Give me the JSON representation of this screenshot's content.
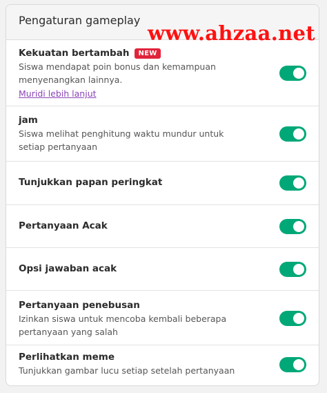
{
  "header": {
    "title": "Pengaturan gameplay",
    "watermark": "www.ahzaa.net"
  },
  "settings": [
    {
      "title": "Kekuatan bertambah",
      "badge": "NEW",
      "description": "Siswa mendapat poin bonus dan kemampuan menyenangkan lainnya.",
      "link": "Muridi lebih lanjut",
      "enabled": true
    },
    {
      "title": "jam",
      "description": "Siswa melihat penghitung waktu mundur untuk setiap pertanyaan",
      "enabled": true
    },
    {
      "title": "Tunjukkan papan peringkat",
      "enabled": true
    },
    {
      "title": "Pertanyaan Acak",
      "enabled": true
    },
    {
      "title": "Opsi jawaban acak",
      "enabled": true
    },
    {
      "title": "Pertanyaan penebusan",
      "description": "Izinkan siswa untuk mencoba kembali beberapa pertanyaan yang salah",
      "enabled": true
    },
    {
      "title": "Perlihatkan meme",
      "description": "Tunjukkan gambar lucu setiap setelah pertanyaan",
      "enabled": true
    }
  ],
  "colors": {
    "toggle_on": "#00a878",
    "badge": "#e0243a",
    "link": "#8a44b8",
    "watermark": "#ff1111"
  }
}
